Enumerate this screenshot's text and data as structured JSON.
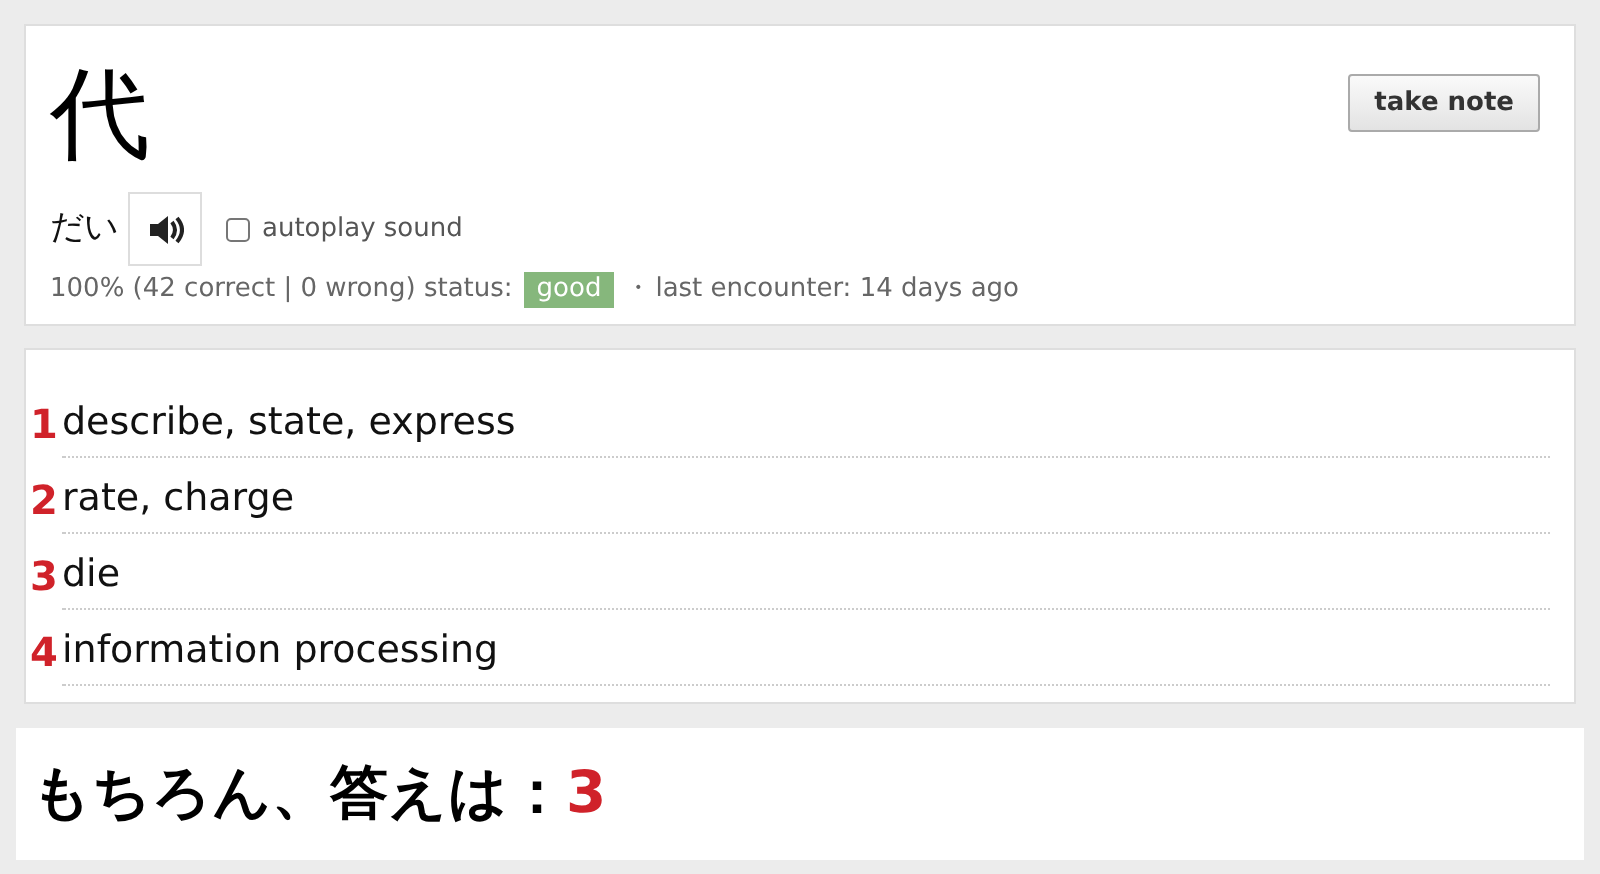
{
  "kanji": "代",
  "reading": "だい",
  "autoplay": {
    "label": "autoplay sound",
    "checked": false
  },
  "take_note_button": "take note",
  "stats": {
    "score": "100% (42 correct | 0 wrong) status:",
    "status": "good",
    "separator": "・",
    "last_encounter": "last encounter: 14 days ago"
  },
  "meanings": [
    {
      "number": "1",
      "text": "describe, state, express"
    },
    {
      "number": "2",
      "text": "rate, charge"
    },
    {
      "number": "3",
      "text": "die"
    },
    {
      "number": "4",
      "text": "information processing"
    }
  ],
  "answer": {
    "prefix": "もちろん、答えは：",
    "value": "3"
  }
}
